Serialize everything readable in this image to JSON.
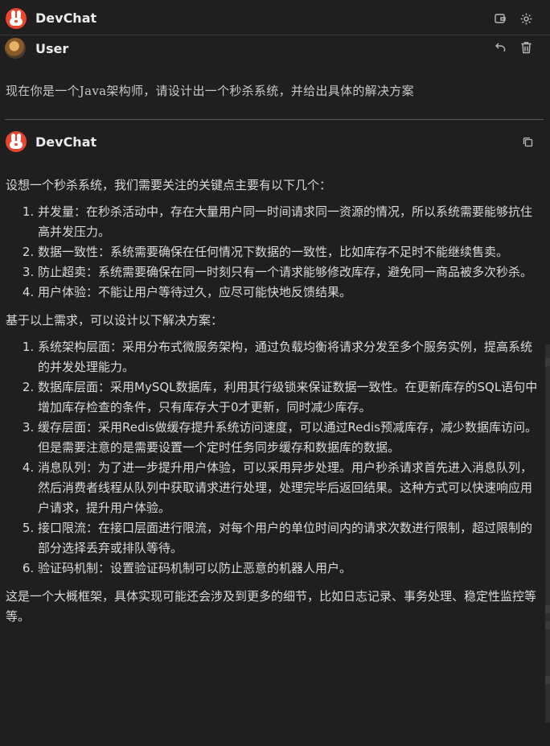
{
  "app": {
    "name": "DevChat"
  },
  "user_message": {
    "author": "User",
    "text": "现在你是一个Java架构师，请设计出一个秒杀系统，并给出具体的解决方案"
  },
  "assistant_message": {
    "author": "DevChat",
    "intro": "设想一个秒杀系统，我们需要关注的关键点主要有以下几个：",
    "key_points": [
      "并发量：在秒杀活动中，存在大量用户同一时间请求同一资源的情况，所以系统需要能够抗住高并发压力。",
      "数据一致性：系统需要确保在任何情况下数据的一致性，比如库存不足时不能继续售卖。",
      "防止超卖：系统需要确保在同一时刻只有一个请求能够修改库存，避免同一商品被多次秒杀。",
      "用户体验：不能让用户等待过久，应尽可能快地反馈结果。"
    ],
    "solution_intro": "基于以上需求，可以设计以下解决方案：",
    "solutions": [
      "系统架构层面：采用分布式微服务架构，通过负载均衡将请求分发至多个服务实例，提高系统的并发处理能力。",
      "数据库层面：采用MySQL数据库，利用其行级锁来保证数据一致性。在更新库存的SQL语句中增加库存检查的条件，只有库存大于0才更新，同时减少库存。",
      "缓存层面：采用Redis做缓存提升系统访问速度，可以通过Redis预减库存，减少数据库访问。但是需要注意的是需要设置一个定时任务同步缓存和数据库的数据。",
      "消息队列：为了进一步提升用户体验，可以采用异步处理。用户秒杀请求首先进入消息队列，然后消费者线程从队列中获取请求进行处理，处理完毕后返回结果。这种方式可以快速响应用户请求，提升用户体验。",
      "接口限流：在接口层面进行限流，对每个用户的单位时间内的请求次数进行限制，超过限制的部分选择丢弃或排队等待。",
      "验证码机制：设置验证码机制可以防止恶意的机器人用户。"
    ],
    "conclusion": "这是一个大概框架，具体实现可能还会涉及到更多的细节，比如日志记录、事务处理、稳定性监控等等。"
  },
  "icons": {
    "header": [
      "wallet-icon",
      "settings-gear-icon"
    ],
    "user_message": [
      "undo-arrow-icon",
      "trash-icon"
    ],
    "assistant_message": [
      "copy-icon"
    ]
  }
}
